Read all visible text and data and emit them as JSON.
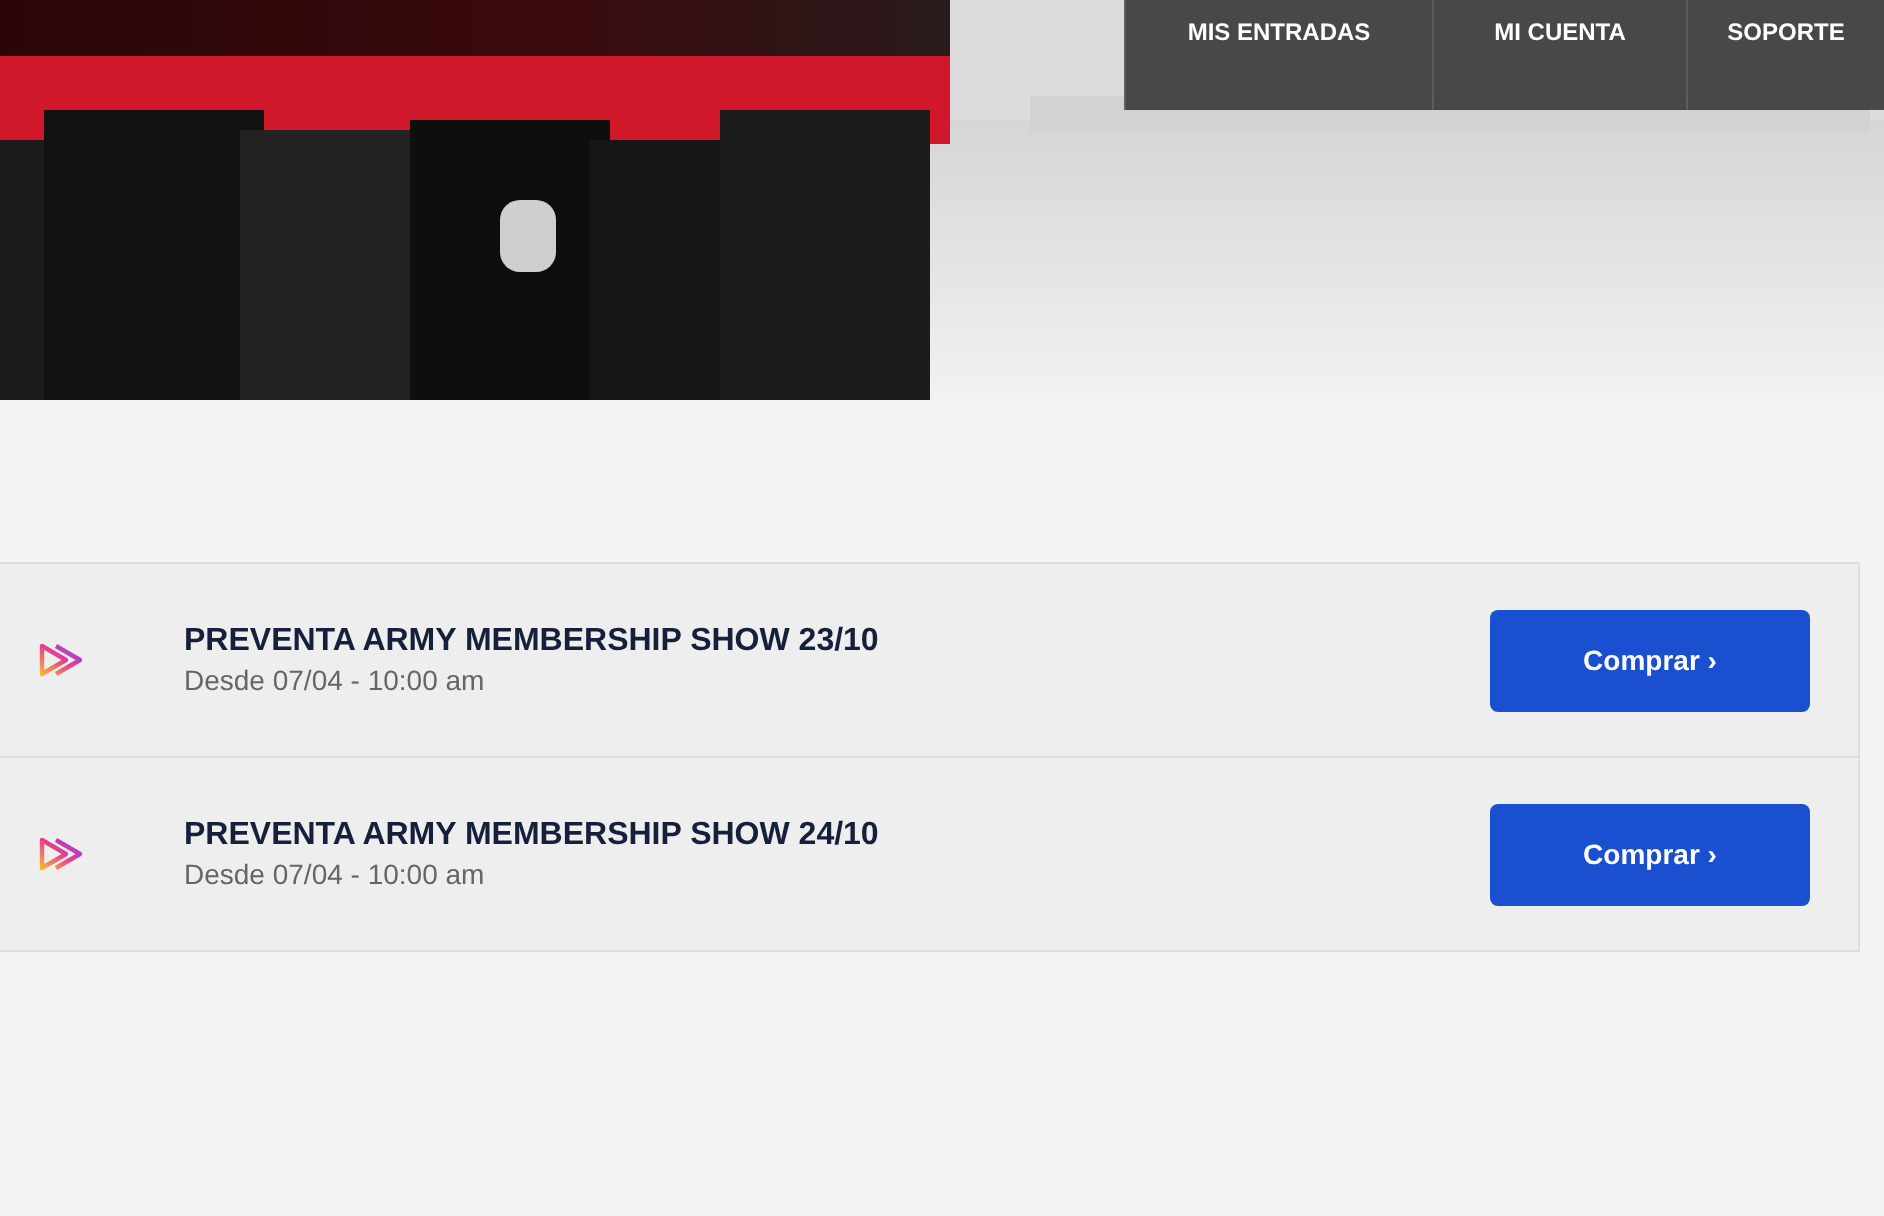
{
  "nav": [
    {
      "label": "MIS ENTRADAS"
    },
    {
      "label": "MI CUENTA"
    },
    {
      "label": "SOPORTE"
    }
  ],
  "events": [
    {
      "title": "PREVENTA ARMY MEMBERSHIP SHOW 23/10",
      "date": "Desde 07/04 - 10:00 am",
      "button": "Comprar ›"
    },
    {
      "title": "PREVENTA ARMY MEMBERSHIP SHOW 24/10",
      "date": "Desde 07/04 - 10:00 am",
      "button": "Comprar ›"
    }
  ]
}
